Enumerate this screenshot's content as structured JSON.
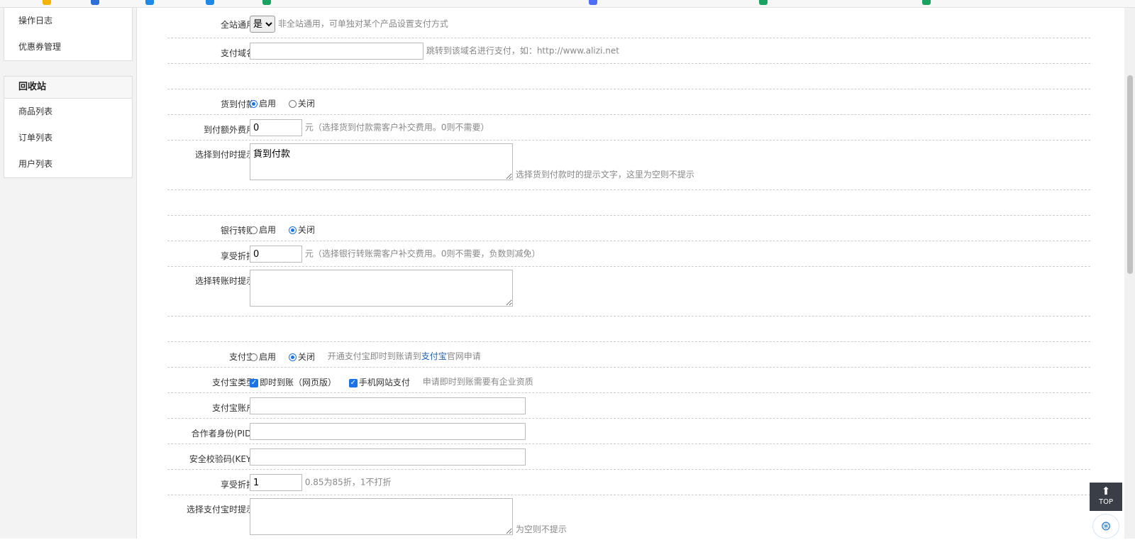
{
  "sidebar": {
    "group1_items": [
      {
        "label": "操作日志"
      },
      {
        "label": "优惠券管理"
      }
    ],
    "recycle": {
      "title": "回收站",
      "items": [
        {
          "label": "商品列表"
        },
        {
          "label": "订单列表"
        },
        {
          "label": "用户列表"
        }
      ]
    }
  },
  "form": {
    "site_wide": {
      "label": "全站通用",
      "selected": "是",
      "hint": "非全站通用，可单独对某个产品设置支付方式"
    },
    "pay_domain": {
      "label": "支付域名",
      "value": "",
      "hint": "跳转到该域名进行支付，如：http://www.alizi.net"
    },
    "cod": {
      "label": "货到付款",
      "opt_on": "启用",
      "opt_off": "关闭"
    },
    "cod_fee": {
      "label": "到付额外费用",
      "value": "0",
      "hint": "元（选择货到付款需客户补交费用。0则不需要）"
    },
    "cod_tip": {
      "label": "选择到付时提示",
      "value": "貨到付款",
      "hint": "选择货到付款时的提示文字，这里为空则不提示"
    },
    "bank": {
      "label": "银行转账",
      "opt_on": "启用",
      "opt_off": "关闭"
    },
    "bank_discount": {
      "label": "享受折扣",
      "value": "0",
      "hint": "元（选择银行转账需客户补交费用。0则不需要，负数则减免）"
    },
    "bank_tip": {
      "label": "选择转账时提示",
      "value": ""
    },
    "alipay": {
      "label": "支付宝",
      "opt_on": "启用",
      "opt_off": "关闭",
      "hint_pre": "开通支付宝即时到账请到",
      "hint_link": "支付宝",
      "hint_post": "官网申请"
    },
    "alipay_type": {
      "label": "支付宝类型",
      "opt1": "即时到账（网页版）",
      "opt2": "手机网站支付",
      "hint": "申请即时到账需要有企业资质"
    },
    "alipay_account": {
      "label": "支付宝账户",
      "value": ""
    },
    "pid": {
      "label": "合作者身份(PID)",
      "value": ""
    },
    "key": {
      "label": "安全校验码(KEY)",
      "value": ""
    },
    "alipay_discount": {
      "label": "享受折扣",
      "value": "1",
      "hint": "0.85为85折，1不打折"
    },
    "alipay_tip": {
      "label": "选择支付宝时提示",
      "value": "",
      "hint": "为空则不提示"
    }
  },
  "float": {
    "top_label": "TOP"
  }
}
